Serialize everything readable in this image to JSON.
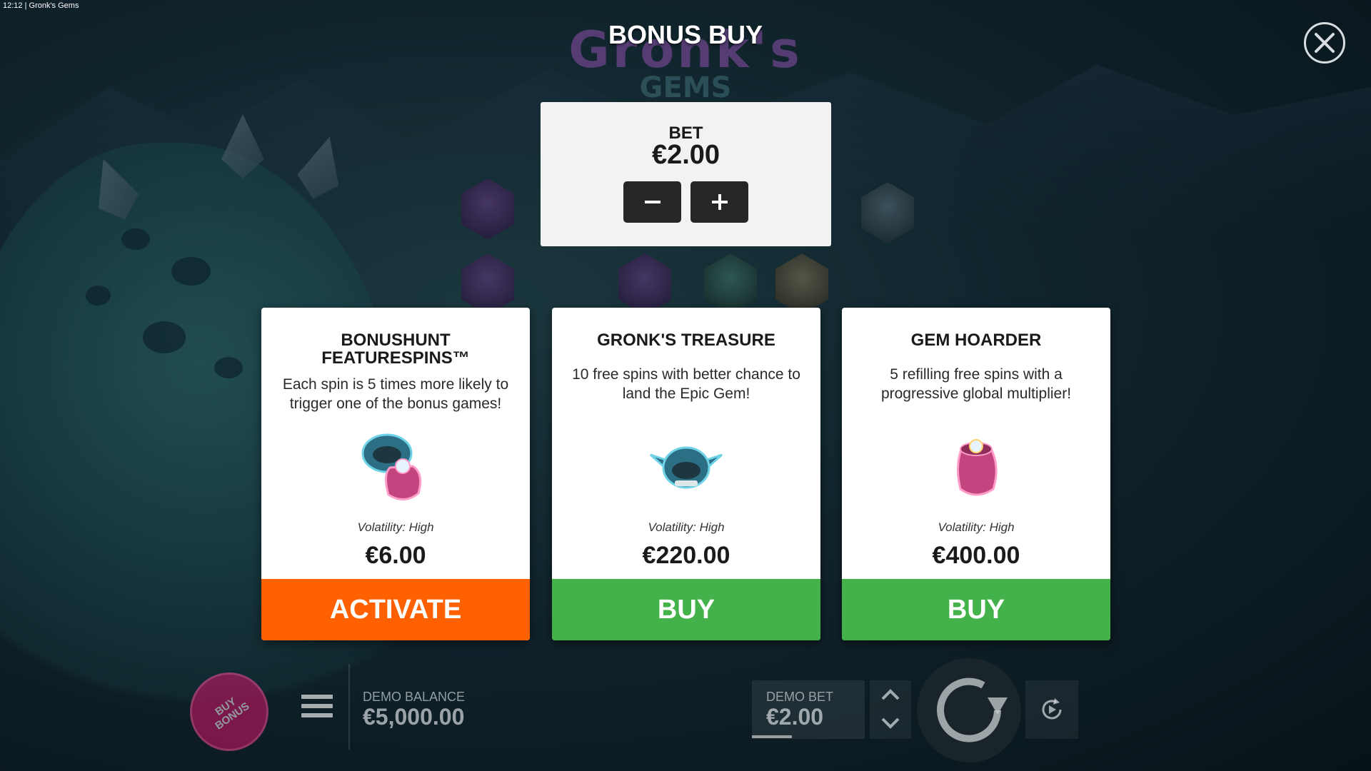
{
  "status_bar": {
    "time": "12:12",
    "app_title": "| Gronk's Gems"
  },
  "logo": {
    "main": "Gronk's",
    "sub": "GEMS"
  },
  "header": {
    "title": "BONUS BUY"
  },
  "bet_panel": {
    "label": "BET",
    "value": "€2.00",
    "decrease": "−",
    "increase": "+"
  },
  "cards": [
    {
      "title_line1": "BONUSHUNT",
      "title_line2": "FEATURESPINS™",
      "description": "Each spin is 5 times more likely to trigger one of the bonus games!",
      "volatility": "Volatility: High",
      "price": "€6.00",
      "button": "ACTIVATE",
      "button_color": "#ff6000"
    },
    {
      "title_line1": "GRONK'S TREASURE",
      "description": "10 free spins with better chance to land the Epic Gem!",
      "volatility": "Volatility: High",
      "price": "€220.00",
      "button": "BUY",
      "button_color": "#44b24a"
    },
    {
      "title_line1": "GEM HOARDER",
      "description": "5 refilling free spins with a progressive global multiplier!",
      "volatility": "Volatility: High",
      "price": "€400.00",
      "button": "BUY",
      "button_color": "#44b24a"
    }
  ],
  "bottom_bar": {
    "buy_bonus_line1": "BUY",
    "buy_bonus_line2": "BONUS",
    "balance_label": "DEMO BALANCE",
    "balance_value": "€5,000.00",
    "bet_label": "DEMO BET",
    "bet_value": "€2.00"
  },
  "icons": [
    "close-icon",
    "minus-icon",
    "plus-icon",
    "menu-icon",
    "chevron-up-icon",
    "chevron-down-icon",
    "spin-icon",
    "autoplay-icon"
  ]
}
